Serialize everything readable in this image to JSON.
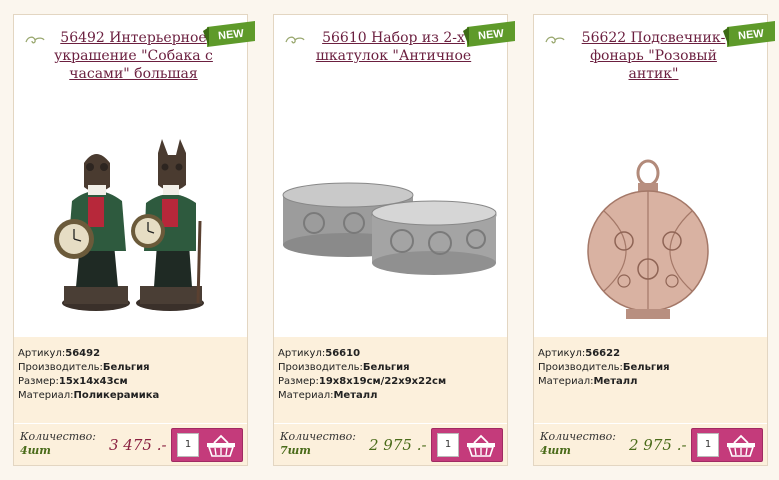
{
  "products": [
    {
      "title": "56492 Интерьерное украшение \"Собака с часами\" большая",
      "badge": "NEW",
      "specs": [
        {
          "label": "Артикул:",
          "value": "56492"
        },
        {
          "label": "Производитель:",
          "value": "Бельгия"
        },
        {
          "label": "Размер:",
          "value": "15х14х43см"
        },
        {
          "label": "Материал:",
          "value": "Поликерамика"
        }
      ],
      "quantity_label": "Количество:",
      "quantity_value": "4шт",
      "price": "3 475 .-",
      "qty_input": "1",
      "price_color": "#8a2040"
    },
    {
      "title": "56610 Набор из 2-х шкатулок \"Античное",
      "badge": "NEW",
      "specs": [
        {
          "label": "Артикул:",
          "value": "56610"
        },
        {
          "label": "Производитель:",
          "value": "Бельгия"
        },
        {
          "label": "Размер:",
          "value": "19х8х19см/22х9х22см"
        },
        {
          "label": "Материал:",
          "value": "Металл"
        }
      ],
      "quantity_label": "Количество:",
      "quantity_value": "7шт",
      "price": "2 975 .-",
      "qty_input": "1",
      "price_color": "#4a6b1a"
    },
    {
      "title": "56622 Подсвечник-фонарь \"Розовый антик\"",
      "badge": "NEW",
      "specs": [
        {
          "label": "Артикул:",
          "value": "56622"
        },
        {
          "label": "Производитель:",
          "value": "Бельгия"
        },
        {
          "label": "Материал:",
          "value": "Металл"
        }
      ],
      "quantity_label": "Количество:",
      "quantity_value": "4шт",
      "price": "2 975 .-",
      "qty_input": "1",
      "price_color": "#4a6b1a"
    }
  ],
  "icons": {
    "swirl": "swirl-ornament-icon",
    "cart": "basket-icon"
  }
}
